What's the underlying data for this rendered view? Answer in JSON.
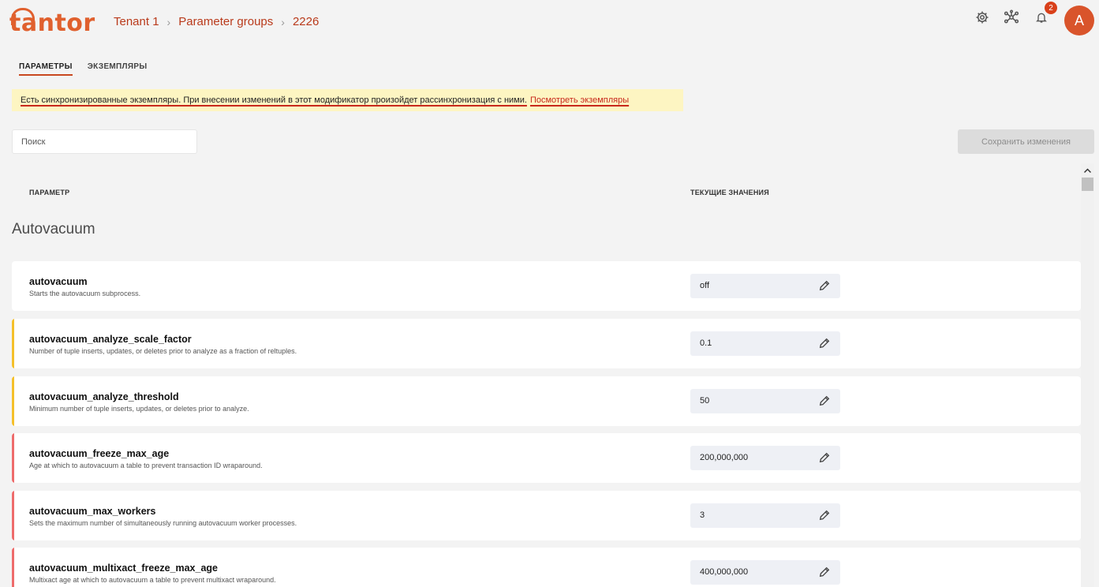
{
  "header": {
    "logo_text": "tantor",
    "breadcrumb": [
      "Tenant 1",
      "Parameter groups",
      "2226"
    ],
    "notifications_count": "2",
    "avatar_letter": "A",
    "icons": [
      "gear-icon",
      "network-icon",
      "bell-icon"
    ]
  },
  "tabs": [
    {
      "label": "ПАРАМЕТРЫ",
      "active": true
    },
    {
      "label": "ЭКЗЕМПЛЯРЫ",
      "active": false
    }
  ],
  "banner": {
    "text": "Есть синхронизированные экземпляры. При внесении изменений в этот модификатор произойдет рассинхронизация с ними.",
    "link": "Посмотреть экземпляры"
  },
  "search": {
    "placeholder": "Поиск",
    "value": ""
  },
  "save_button": "Сохранить изменения",
  "table": {
    "col_param": "ПАРАМЕТР",
    "col_value": "ТЕКУЩИЕ ЗНАЧЕНИЯ",
    "group_title": "Autovacuum",
    "rows": [
      {
        "name": "autovacuum",
        "desc": "Starts the autovacuum subprocess.",
        "value": "off",
        "accent": ""
      },
      {
        "name": "autovacuum_analyze_scale_factor",
        "desc": "Number of tuple inserts, updates, or deletes prior to analyze as a fraction of reltuples.",
        "value": "0.1",
        "accent": "#f5c02a"
      },
      {
        "name": "autovacuum_analyze_threshold",
        "desc": "Minimum number of tuple inserts, updates, or deletes prior to analyze.",
        "value": "50",
        "accent": "#f5c02a"
      },
      {
        "name": "autovacuum_freeze_max_age",
        "desc": "Age at which to autovacuum a table to prevent transaction ID wraparound.",
        "value": "200,000,000",
        "accent": "#ee6b6b"
      },
      {
        "name": "autovacuum_max_workers",
        "desc": "Sets the maximum number of simultaneously running autovacuum worker processes.",
        "value": "3",
        "accent": "#ee6b6b"
      },
      {
        "name": "autovacuum_multixact_freeze_max_age",
        "desc": "Multixact age at which to autovacuum a table to prevent multixact wraparound.",
        "value": "400,000,000",
        "accent": "#ee6b6b"
      }
    ]
  },
  "colors": {
    "brand": "#e0602e",
    "breadcrumb": "#b93a1b",
    "warning_bg": "#fdf5c2",
    "link": "#c8281b"
  }
}
